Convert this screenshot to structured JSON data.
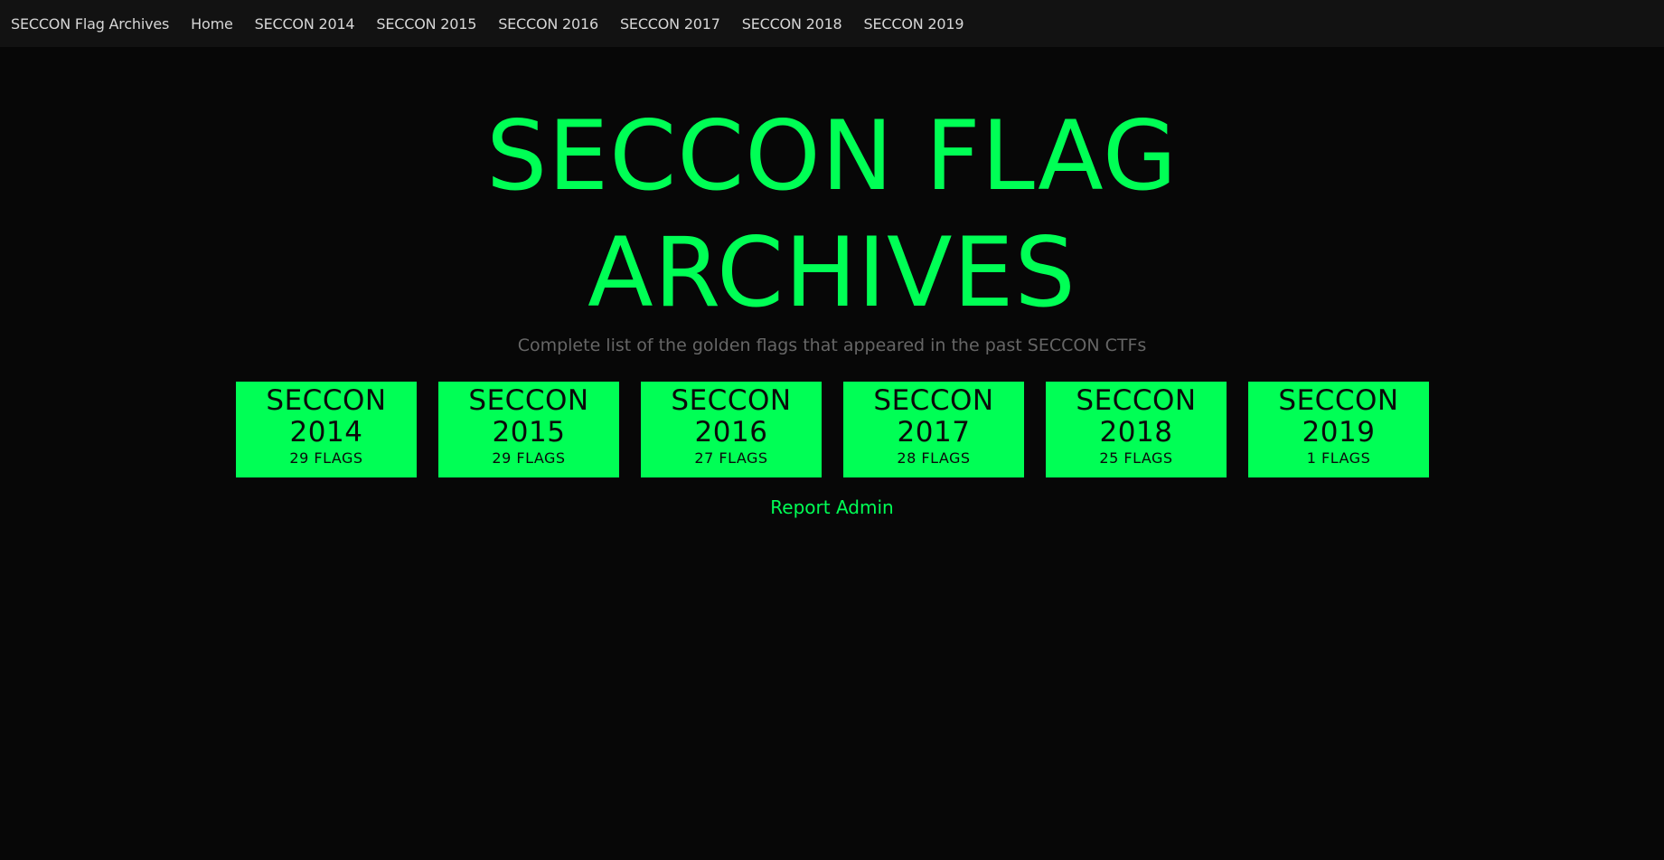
{
  "navbar": {
    "brand": "SECCON Flag Archives",
    "links": [
      "Home",
      "SECCON 2014",
      "SECCON 2015",
      "SECCON 2016",
      "SECCON 2017",
      "SECCON 2018",
      "SECCON 2019"
    ]
  },
  "hero": {
    "title_line1": "SECCON FLAG",
    "title_line2": "ARCHIVES",
    "subtitle": "Complete list of the golden flags that appeared in the past SECCON CTFs"
  },
  "cards": [
    {
      "name": "SECCON",
      "year": "2014",
      "count": "29 FLAGS"
    },
    {
      "name": "SECCON",
      "year": "2015",
      "count": "29 FLAGS"
    },
    {
      "name": "SECCON",
      "year": "2016",
      "count": "27 FLAGS"
    },
    {
      "name": "SECCON",
      "year": "2017",
      "count": "28 FLAGS"
    },
    {
      "name": "SECCON",
      "year": "2018",
      "count": "25 FLAGS"
    },
    {
      "name": "SECCON",
      "year": "2019",
      "count": "1 FLAGS"
    }
  ],
  "report_link": "Report Admin",
  "colors": {
    "accent": "#00ff55",
    "background": "#070707",
    "navbar": "#121212",
    "subtitle": "#666666"
  }
}
